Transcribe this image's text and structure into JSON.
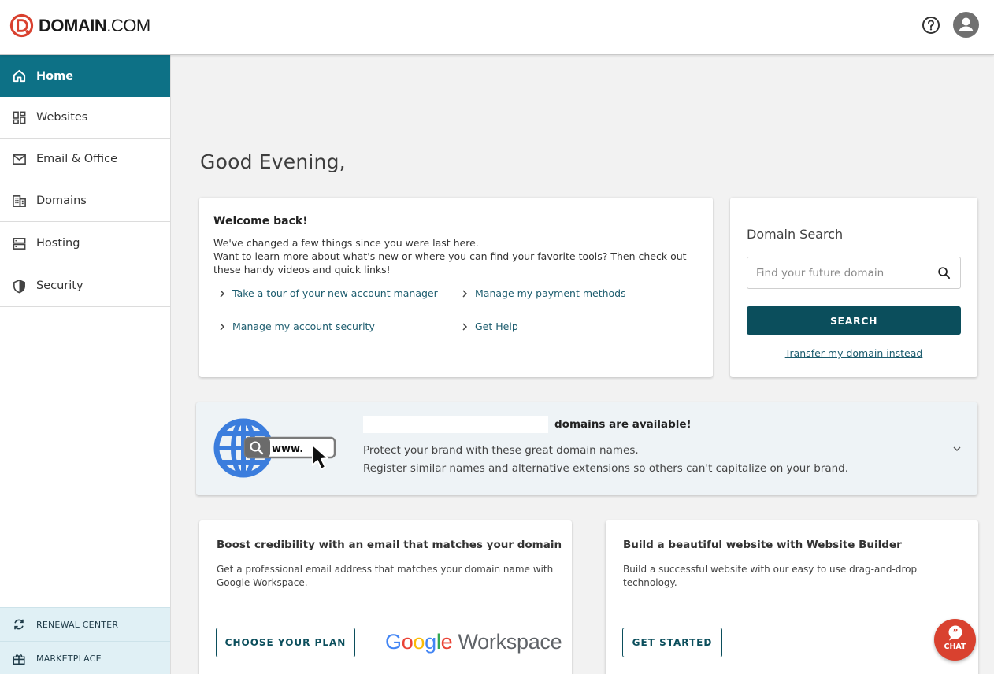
{
  "header": {
    "logo_brand": "DOMAIN",
    "logo_suffix": ".COM",
    "help_icon": "help-circle-icon",
    "avatar_icon": "user-icon"
  },
  "sidebar": {
    "items": [
      {
        "label": "Home",
        "icon": "home-icon",
        "active": true
      },
      {
        "label": "Websites",
        "icon": "dashboard-icon"
      },
      {
        "label": "Email & Office",
        "icon": "mail-icon"
      },
      {
        "label": "Domains",
        "icon": "building-icon"
      },
      {
        "label": "Hosting",
        "icon": "server-icon"
      },
      {
        "label": "Security",
        "icon": "shield-icon"
      }
    ],
    "bottom": [
      {
        "label": "RENEWAL CENTER",
        "icon": "refresh-icon"
      },
      {
        "label": "MARKETPLACE",
        "icon": "gift-icon"
      }
    ]
  },
  "main": {
    "greeting": "Good Evening,",
    "welcome": {
      "title": "Welcome back!",
      "line1": "We've changed a few things since you were last here.",
      "line2": "Want to learn more about what's new or where you can find your favorite tools? Then check out these handy videos and quick links!",
      "links": [
        "Take a tour of your new account manager",
        "Manage my payment methods",
        "Manage my account security",
        "Get Help"
      ]
    },
    "domain_search": {
      "title": "Domain Search",
      "placeholder": "Find your future domain",
      "value": "",
      "button": "SEARCH",
      "transfer_link": "Transfer my domain instead"
    },
    "banner": {
      "title": "domains are available!",
      "line1": "Protect your brand with these great domain names.",
      "line2": "Register similar names and alternative extensions so others can't capitalize on your brand.",
      "art_text": "www."
    },
    "promo_email": {
      "title": "Boost credibility with an email that matches your domain",
      "desc": "Get a professional email address that matches your domain name with Google Workspace.",
      "button": "CHOOSE YOUR PLAN",
      "logo_g": "Google",
      "logo_ws": "Workspace"
    },
    "promo_site": {
      "title": "Build a beautiful website with Website Builder",
      "desc": "Build a successful website with our easy to use drag-and-drop technology.",
      "button": "GET STARTED"
    }
  },
  "chat": {
    "label": "CHAT"
  },
  "colors": {
    "accent": "#0d7186",
    "primary_button": "#0b4e5c",
    "link": "#1c5c6e",
    "brand_red": "#d9412f"
  }
}
